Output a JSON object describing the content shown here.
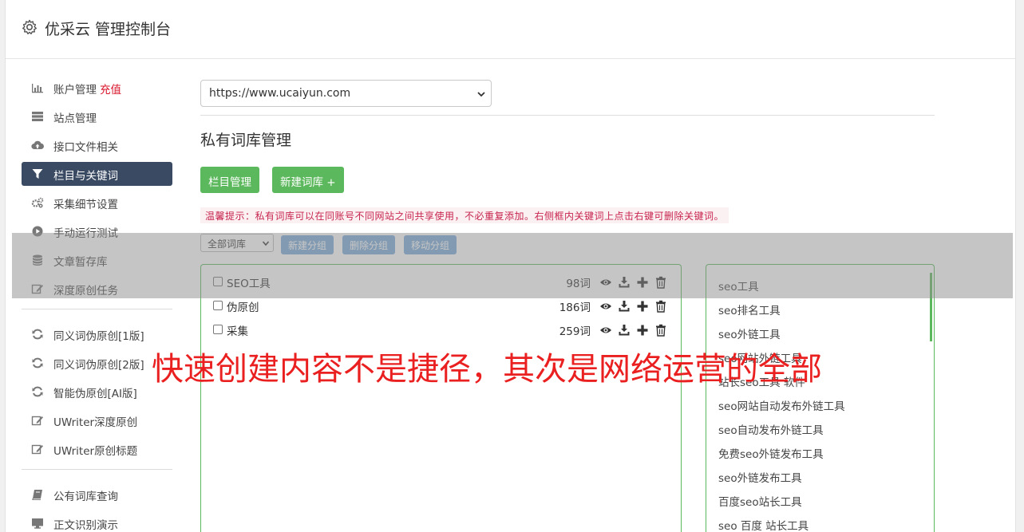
{
  "header": {
    "title": "优采云 管理控制台"
  },
  "sidebar": {
    "group1": [
      {
        "label": "账户管理",
        "badge": "充值",
        "icon": "bar-chart-icon"
      },
      {
        "label": "站点管理",
        "icon": "server-icon"
      },
      {
        "label": "接口文件相关",
        "icon": "cloud-upload-icon"
      },
      {
        "label": "栏目与关键词",
        "icon": "filter-icon",
        "active": true
      },
      {
        "label": "采集细节设置",
        "icon": "cogs-icon"
      },
      {
        "label": "手动运行测试",
        "icon": "play-icon"
      },
      {
        "label": "文章暂存库",
        "icon": "database-icon"
      },
      {
        "label": "深度原创任务",
        "icon": "edit-icon"
      }
    ],
    "group2": [
      {
        "label": "同义词伪原创[1版]",
        "icon": "refresh-icon"
      },
      {
        "label": "同义词伪原创[2版]",
        "icon": "refresh-icon"
      },
      {
        "label": "智能伪原创[AI版]",
        "icon": "refresh-icon"
      },
      {
        "label": "UWriter深度原创",
        "icon": "edit-icon"
      },
      {
        "label": "UWriter原创标题",
        "icon": "edit-icon"
      }
    ],
    "group3": [
      {
        "label": "公有词库查询",
        "icon": "book-icon"
      },
      {
        "label": "正文识别演示",
        "icon": "monitor-icon"
      }
    ]
  },
  "main": {
    "site_select": "https://www.ucaiyun.com",
    "page_title": "私有词库管理",
    "btn_columns": "栏目管理",
    "btn_new_dict": "新建词库 +",
    "tip": "温馨提示：私有词库可以在同账号不同网站之间共享使用，不必重复添加。右侧框内关键词上点击右键可删除关键词。",
    "group_select": "全部词库",
    "btn_new_group": "新建分组",
    "btn_delete_group": "删除分组",
    "btn_move_group": "移动分组",
    "dicts": [
      {
        "name": "SEO工具",
        "count": "98词"
      },
      {
        "name": "伪原创",
        "count": "186词"
      },
      {
        "name": "采集",
        "count": "259词"
      }
    ],
    "keywords": [
      "seo工具",
      "seo排名工具",
      "seo外链工具",
      "seo网站外链工具",
      "站长seo工具 软件",
      "seo网站自动发布外链工具",
      "seo自动发布外链工具",
      "免费seo外链发布工具",
      "seo外链发布工具",
      "百度seo站长工具",
      "seo 百度 站长工具"
    ]
  },
  "caption": "快速创建内容不是捷径，其次是网络运营的全部",
  "colors": {
    "active_nav": "#3a4a63",
    "green": "#5cb85c",
    "blue_btn": "#7aaad8",
    "caption_red": "#ea1f1f",
    "badge_red": "#d9142a"
  }
}
